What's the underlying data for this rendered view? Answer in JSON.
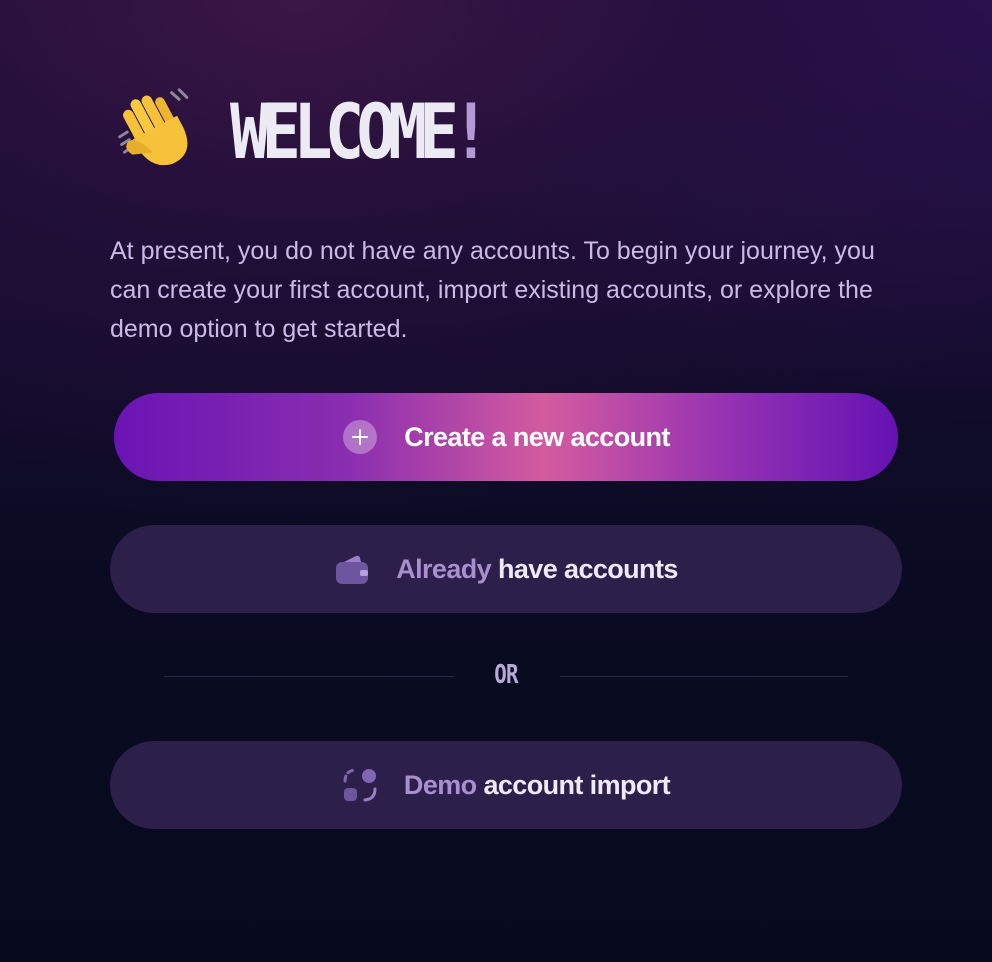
{
  "header": {
    "emoji_icon": "waving-hand-icon",
    "title": "WELCOME",
    "title_punct": "!"
  },
  "intro": {
    "text": "At present, you do not have any accounts. To begin your journey, you can create your first account, import existing accounts, or explore the demo option to get started."
  },
  "actions": {
    "create": {
      "icon": "plus-circle-icon",
      "label": "Create a new account"
    },
    "existing": {
      "icon": "wallet-icon",
      "label_muted": "Already",
      "label_bright": "have accounts"
    },
    "separator": "OR",
    "demo": {
      "icon": "demo-import-icon",
      "label_muted": "Demo",
      "label_bright": "account import"
    }
  },
  "colors": {
    "accent_purple": "#6a14b4",
    "accent_pink": "#d45ba0",
    "secondary_button": "#2c1f49",
    "muted_text": "#a98fd0"
  }
}
